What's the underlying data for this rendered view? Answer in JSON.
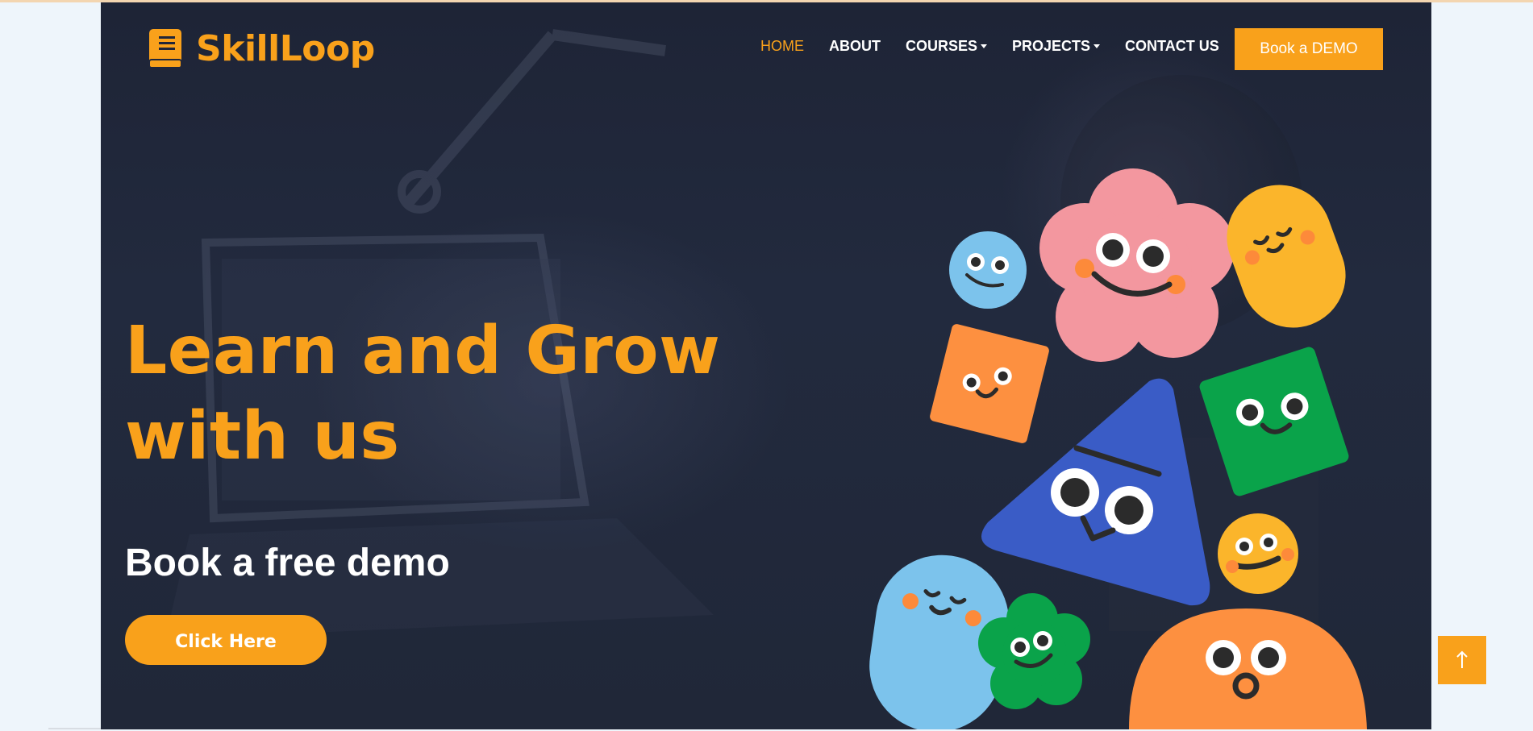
{
  "brand": {
    "name": "SkillLoop",
    "color": "#f9a11b"
  },
  "nav": {
    "items": [
      {
        "label": "HOME",
        "active": true
      },
      {
        "label": "ABOUT"
      },
      {
        "label": "COURSES",
        "dropdown": true
      },
      {
        "label": "PROJECTS",
        "dropdown": true
      },
      {
        "label": "CONTACT US"
      }
    ],
    "cta_label": "Book a DEMO"
  },
  "hero": {
    "headline_line1": "Learn and Grow",
    "headline_line2": "with us",
    "subheading": "Book a free demo",
    "button_label": "Click Here"
  },
  "icons": {
    "logo": "book-icon",
    "scroll_top": "arrow-up-icon",
    "dropdown": "caret-down-icon"
  }
}
